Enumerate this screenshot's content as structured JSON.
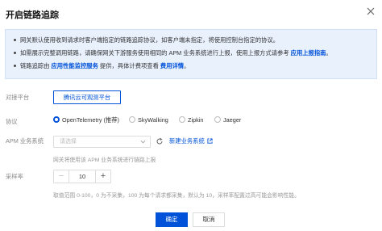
{
  "dialog": {
    "title": "开启链路追踪"
  },
  "notice": {
    "line1": "网关默认使用收到请求时客户端指定的链路追踪协议，如客户端未指定，将使用控制台指定的协议。",
    "line2_prefix": "如需展示完整调用链路，请确保网关下游服务使用相同的 APM 业务系统进行上报，使用上报方式请参考 ",
    "line2_link": "应用上报指南",
    "line2_suffix": "。",
    "line3_prefix": "链路追踪由 ",
    "line3_link1": "应用性能监控服务",
    "line3_mid": " 提供，具体计费项查看 ",
    "line3_link2": "费用详情",
    "line3_suffix": "。"
  },
  "form": {
    "platform_label": "对接平台",
    "platform_button": "腾讯云可观测平台",
    "protocol_label": "协议",
    "protocols": [
      {
        "label": "OpenTelemetry (推荐)",
        "checked": true
      },
      {
        "label": "SkyWalking",
        "checked": false
      },
      {
        "label": "Zipkin",
        "checked": false
      },
      {
        "label": "Jaeger",
        "checked": false
      }
    ],
    "apm_label": "APM 业务系统",
    "apm_placeholder": "请选择",
    "new_system_link": "新建业务系统",
    "apm_help": "网关将使用该 APM 业务系统进行链路上报",
    "sampling_label": "采样率",
    "sampling_value": "10",
    "minus": "−",
    "plus": "+",
    "sampling_help": "取值范围 0-100，0 为不采集，100 为每个请求都采集，默认为 10，采样率配置过高可能会影响性能。"
  },
  "footer": {
    "confirm": "确定",
    "cancel": "取消"
  },
  "colors": {
    "primary": "#0052d9",
    "notice_bg": "#e9f1fd"
  }
}
